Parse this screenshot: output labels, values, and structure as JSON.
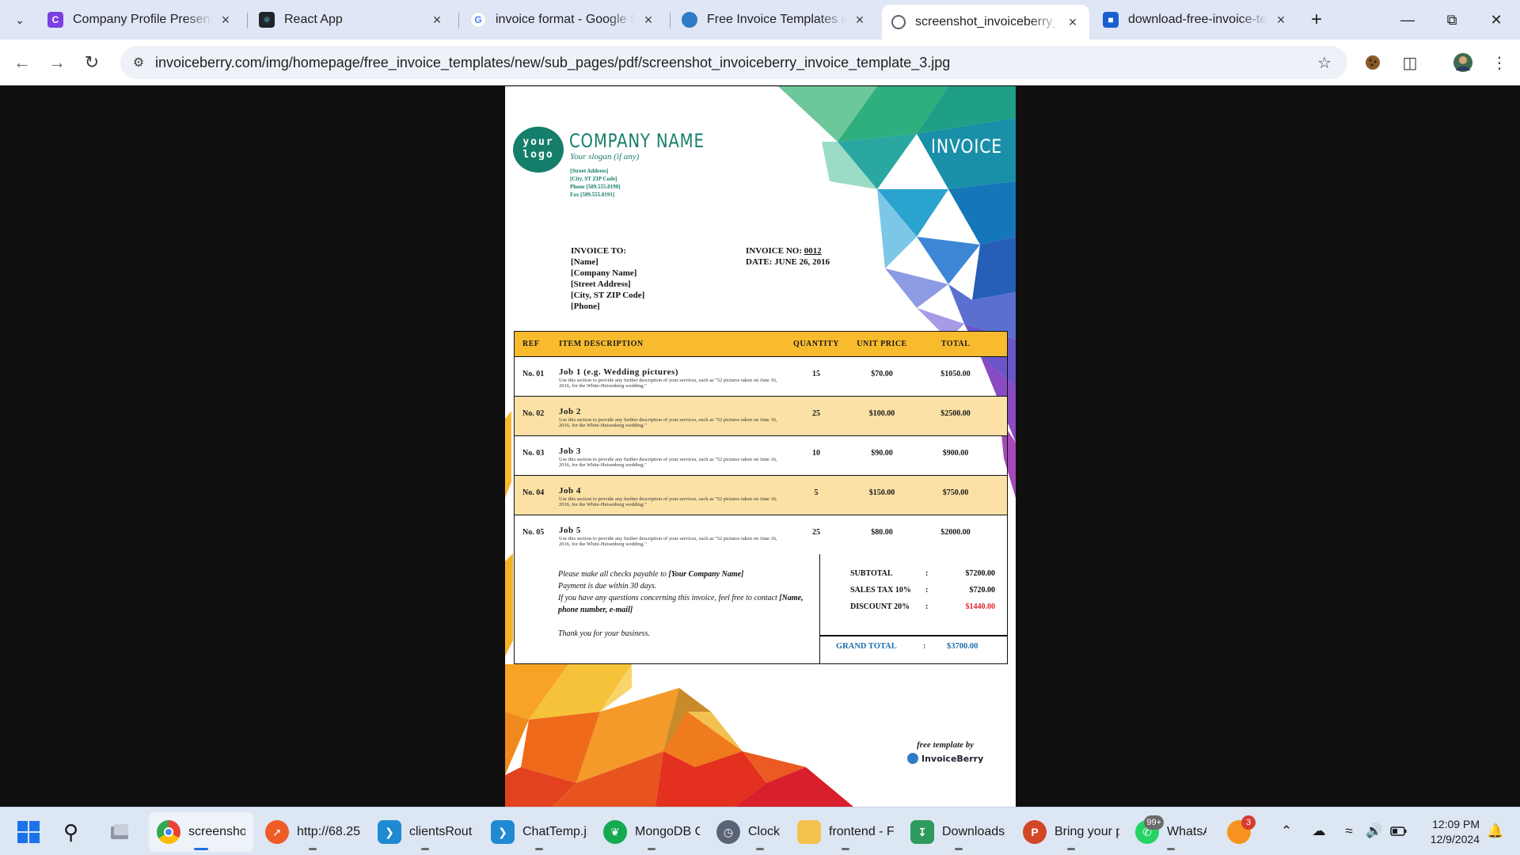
{
  "tabs": [
    {
      "title": "Company Profile Presentat",
      "icon": "canva-icon",
      "color": "#7b3fe4"
    },
    {
      "title": "React App",
      "icon": "react-icon",
      "color": "#20232a"
    },
    {
      "title": "invoice format - Google Se",
      "icon": "google-icon",
      "color": "#ffffff"
    },
    {
      "title": "Free Invoice Templates in P",
      "icon": "invoiceberry-icon",
      "color": "#2d7cc5"
    },
    {
      "title": "screenshot_invoiceberry_in",
      "icon": "globe-icon",
      "color": "#ffffff"
    },
    {
      "title": "download-free-invoice-ter",
      "icon": "doc-icon",
      "color": "#1a5fd0"
    }
  ],
  "address_bar": {
    "url": "invoiceberry.com/img/homepage/free_invoice_templates/new/sub_pages/pdf/screenshot_invoiceberry_invoice_template_3.jpg"
  },
  "invoice": {
    "logo_line1": "your",
    "logo_line2": "logo",
    "company_name": "COMPANY NAME",
    "slogan": "Your slogan (if any)",
    "street": "[Street Address]",
    "city": "[City, ST  ZIP Code]",
    "phone": "Phone [509.555.0190]",
    "fax": "Fax [509.555.0191]",
    "heading": "INVOICE",
    "to_label": "INVOICE TO:",
    "to_name": "[Name]",
    "to_company": "[Company Name]",
    "to_street": "[Street Address]",
    "to_city": "[City, ST  ZIP Code]",
    "to_phone": "[Phone]",
    "no_label": "INVOICE NO:",
    "no_value": "0012",
    "date_text": "DATE: JUNE 26, 2016",
    "columns": {
      "ref": "REF",
      "desc": "ITEM DESCRIPTION",
      "qty": "QUANTITY",
      "unit": "UNIT PRICE",
      "total": "TOTAL"
    },
    "items": [
      {
        "ref": "No. 01",
        "job": "Job 1 (e.g. Wedding pictures)",
        "desc": "Use this section to provide any further description of your services, such as \"52 pictures taken on June 16, 2016, for the White-Heisenberg wedding.\"",
        "qty": "15",
        "unit": "$70.00",
        "total": "$1050.00"
      },
      {
        "ref": "No. 02",
        "job": "Job 2",
        "desc": "Use this section to provide any further description of your services, such as \"52 pictures taken on June 16, 2016, for the White-Heisenberg wedding.\"",
        "qty": "25",
        "unit": "$100.00",
        "total": "$2500.00"
      },
      {
        "ref": "No. 03",
        "job": "Job 3",
        "desc": "Use this section to provide any further description of your services, such as \"52 pictures taken on June 16, 2016, for the White-Heisenberg wedding.\"",
        "qty": "10",
        "unit": "$90.00",
        "total": "$900.00"
      },
      {
        "ref": "No. 04",
        "job": "Job 4",
        "desc": "Use this section to provide any further description of your services, such as \"52 pictures taken on June 16, 2016, for the White-Heisenberg wedding.\"",
        "qty": "5",
        "unit": "$150.00",
        "total": "$750.00"
      },
      {
        "ref": "No. 05",
        "job": "Job 5",
        "desc": "Use this section to provide any further description of your services, such as \"52 pictures taken on June 16, 2016, for the White-Heisenberg wedding.\"",
        "qty": "25",
        "unit": "$80.00",
        "total": "$2000.00"
      }
    ],
    "note_payable": "Please make all checks payable to",
    "note_payable_name": "[Your Company Name]",
    "note_due": "Payment is due within 30 days.",
    "note_questions": "If you have any questions concerning this invoice, feel free to contact",
    "note_contact": "[Name, phone number, e-mail]",
    "note_thanks": "Thank you for your business.",
    "subtotal_label": "SUBTOTAL",
    "subtotal": "$7200.00",
    "tax_label": "SALES TAX 10%",
    "tax": "$720.00",
    "discount_label": "DISCOUNT 20%",
    "discount": "$1440.00",
    "grand_label": "GRAND TOTAL",
    "grand_total": "$3700.00",
    "colon": ":",
    "credit_by": "free template by",
    "credit_brand": "InvoiceBerry"
  },
  "taskbar": {
    "items": [
      {
        "label": "screenshot_",
        "icon": "chrome-icon"
      },
      {
        "label": "http://68.25",
        "icon": "postman-icon"
      },
      {
        "label": "clientsRoute",
        "icon": "vscode-icon"
      },
      {
        "label": "ChatTemp.js",
        "icon": "vscode-icon"
      },
      {
        "label": "MongoDB C",
        "icon": "mongodb-icon"
      },
      {
        "label": "Clock",
        "icon": "clock-icon"
      },
      {
        "label": "frontend - F",
        "icon": "folder-icon"
      },
      {
        "label": "Downloads",
        "icon": "downloads-icon"
      },
      {
        "label": "Bring your p",
        "icon": "powerpoint-icon"
      },
      {
        "label": "WhatsA",
        "icon": "whatsapp-icon",
        "badge": "99+"
      }
    ],
    "extra_badge": "3",
    "time": "12:09 PM",
    "date": "12/9/2024"
  }
}
